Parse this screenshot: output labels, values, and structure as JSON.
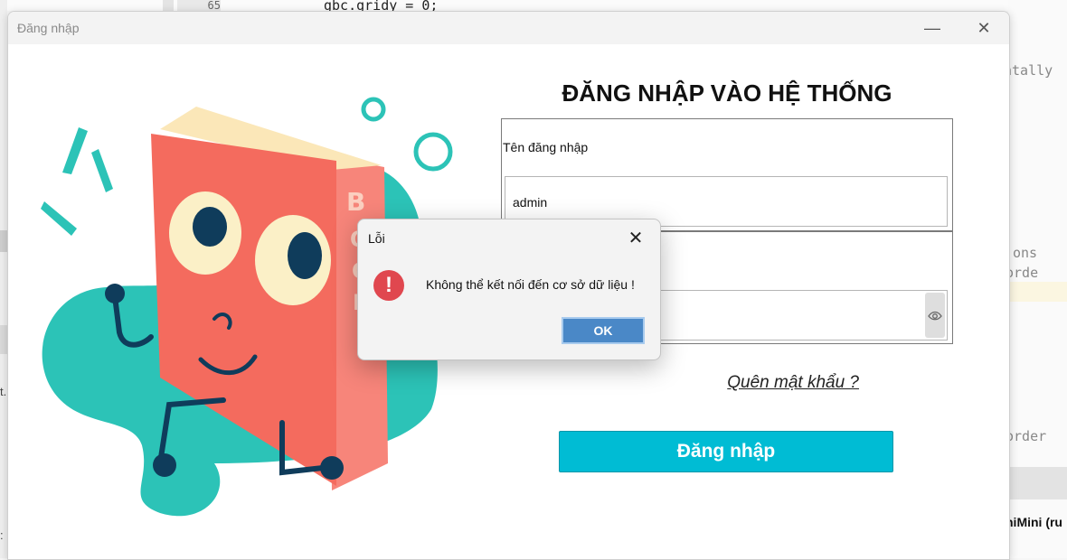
{
  "background_ide": {
    "line_number": "65",
    "code_line": "gbc.gridy = 0;",
    "right_fragments": [
      "ntally",
      "ons",
      "orde",
      "order"
    ],
    "right_bold": "hiMini (ru",
    "left_fragments": [
      "t.",
      ":"
    ]
  },
  "window": {
    "title": "Đăng nhập",
    "minimize_glyph": "—",
    "close_glyph": "✕"
  },
  "login": {
    "heading": "ĐĂNG NHẬP VÀO HỆ THỐNG",
    "username_label": "Tên đăng nhập",
    "username_value": "admin",
    "forgot_password": "Quên mật khẩu ?",
    "login_button": "Đăng nhập"
  },
  "dialog": {
    "title": "Lỗi",
    "close_glyph": "✕",
    "icon_glyph": "!",
    "message": "Không thể kết nối đến cơ sở dữ liệu !",
    "ok_button": "OK"
  },
  "colors": {
    "accent": "#00bcd4",
    "error": "#e0474f",
    "ok_button": "#4a88c7",
    "illustration_teal": "#2cc3b7",
    "book_red": "#f46b5e"
  }
}
